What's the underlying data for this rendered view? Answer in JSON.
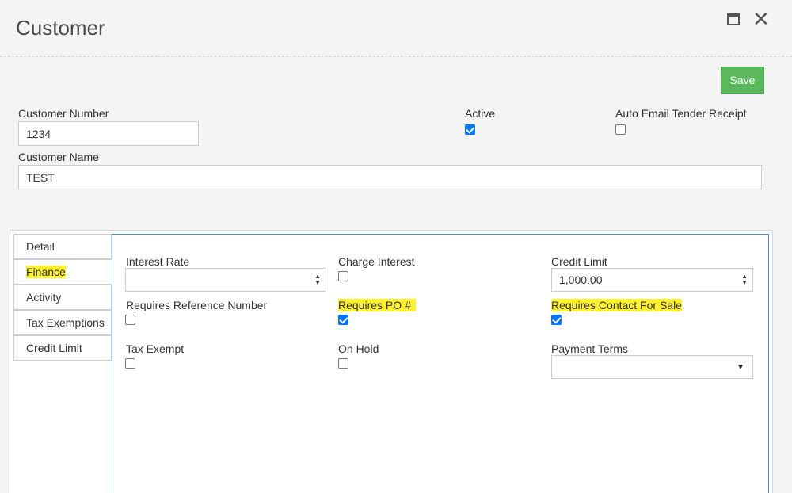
{
  "window": {
    "title": "Customer"
  },
  "toolbar": {
    "save_label": "Save",
    "save_color": "#5cb85c"
  },
  "form": {
    "customer_number_label": "Customer Number",
    "customer_number_value": "1234",
    "active_label": "Active",
    "active_checked": true,
    "auto_email_label": "Auto Email Tender Receipt",
    "auto_email_checked": false,
    "customer_name_label": "Customer Name",
    "customer_name_value": "TEST"
  },
  "tabs": [
    {
      "label": "Detail",
      "active": false
    },
    {
      "label": "Finance",
      "active": true
    },
    {
      "label": "Activity",
      "active": false
    },
    {
      "label": "Tax Exemptions",
      "active": false
    },
    {
      "label": "Credit Limit",
      "active": false
    }
  ],
  "finance": {
    "interest_rate_label": "Interest Rate",
    "interest_rate_value": "",
    "charge_interest_label": "Charge Interest",
    "charge_interest_checked": false,
    "credit_limit_label": "Credit Limit",
    "credit_limit_value": "1,000.00",
    "requires_reference_label": "Requires Reference Number",
    "requires_reference_checked": false,
    "requires_po_label": "Requires PO #",
    "requires_po_checked": true,
    "requires_contact_label": "Requires Contact For Sale",
    "requires_contact_checked": true,
    "tax_exempt_label": "Tax Exempt",
    "tax_exempt_checked": false,
    "on_hold_label": "On Hold",
    "on_hold_checked": false,
    "payment_terms_label": "Payment Terms",
    "payment_terms_value": ""
  },
  "colors": {
    "highlight": "#fff12e",
    "panel_border": "#4a90c8",
    "checkbox_on": "#0075ff"
  }
}
